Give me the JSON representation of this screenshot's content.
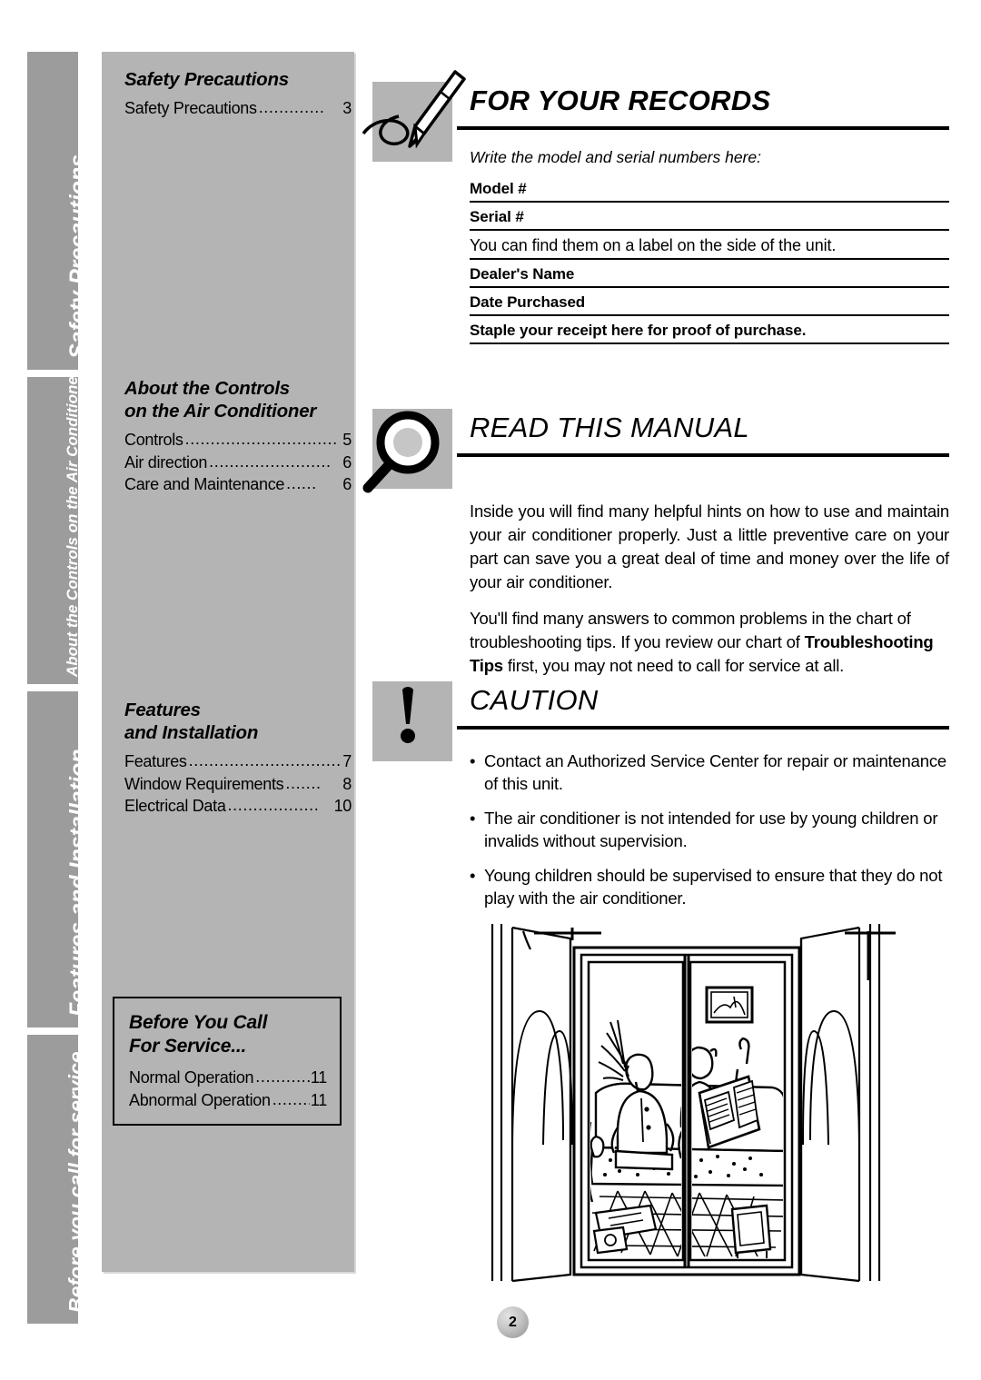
{
  "side_tabs": [
    {
      "label": "Safety Precautions"
    },
    {
      "label": "About the Controls on the Air Conditioner"
    },
    {
      "label": "Features and Installation"
    },
    {
      "label": "Before you call for service..."
    }
  ],
  "toc": {
    "groups": [
      {
        "heading": "Safety Precautions",
        "entries": [
          {
            "title": "Safety Precautions",
            "dots": ".............",
            "page": "3"
          }
        ]
      },
      {
        "heading": "About the Controls\non the Air Conditioner",
        "heading_line1": "About the Controls",
        "heading_line2": "on the Air Conditioner",
        "entries": [
          {
            "title": "Controls",
            "dots": "..............................",
            "page": "5"
          },
          {
            "title": "Air direction",
            "dots": "........................",
            "page": "6"
          },
          {
            "title": "Care and Maintenance",
            "dots": "......",
            "page": "6"
          }
        ]
      },
      {
        "heading_line1": "Features",
        "heading_line2": "and Installation",
        "entries": [
          {
            "title": "Features",
            "dots": "..............................",
            "page": "7"
          },
          {
            "title": "Window Requirements",
            "dots": ".......",
            "page": "8"
          },
          {
            "title": "Electrical Data",
            "dots": "..................",
            "page": "10"
          }
        ]
      }
    ],
    "boxed_group": {
      "heading_line1": "Before You Call",
      "heading_line2": "For Service...",
      "entries": [
        {
          "title": "Normal Operation",
          "dots": "............",
          "page": "11"
        },
        {
          "title": "Abnormal Operation",
          "dots": ".........",
          "page": "11"
        }
      ]
    }
  },
  "sections": {
    "records": {
      "icon": "pen-writing-icon",
      "title": "FOR YOUR RECORDS",
      "note": "Write the model and serial numbers here:",
      "rows": [
        {
          "label": "Model #",
          "bold": true
        },
        {
          "label": "Serial #",
          "bold": true
        },
        {
          "label": "You can find them on a label on the side of the unit.",
          "bold": false
        },
        {
          "label": "Dealer's Name",
          "bold": true
        },
        {
          "label": "Date Purchased",
          "bold": true
        },
        {
          "label": "Staple your receipt here for proof of purchase.",
          "bold": true
        }
      ]
    },
    "manual": {
      "icon": "magnifying-glass-icon",
      "title": "READ THIS MANUAL",
      "paragraph_1": "Inside you will find many helpful hints on how to use and maintain your air conditioner properly. Just a little preventive care on your part can save you a great deal of time and money over the life of your air conditioner.",
      "paragraph_2_part_1": "You'll find many answers to common problems in the chart of troubleshooting tips. If you review our chart of ",
      "paragraph_2_bold": "Troubleshooting Tips",
      "paragraph_2_part_2": " first, you may not need to call for service at all."
    },
    "caution": {
      "icon": "exclamation-mark-icon",
      "title": "CAUTION",
      "bullets": [
        "Contact an Authorized Service Center for repair or maintenance of this unit.",
        "The air conditioner is not intended for use by young children or invalids without supervision.",
        "Young children should be supervised to ensure that they do not play with the air conditioner."
      ]
    }
  },
  "illustration": {
    "name": "room-with-window-air-conditioner-illustration"
  },
  "page_number": "2",
  "colors": {
    "tab_gray": "#9c9c9c",
    "panel_gray": "#b4b4b4",
    "rule_black": "#000000"
  }
}
